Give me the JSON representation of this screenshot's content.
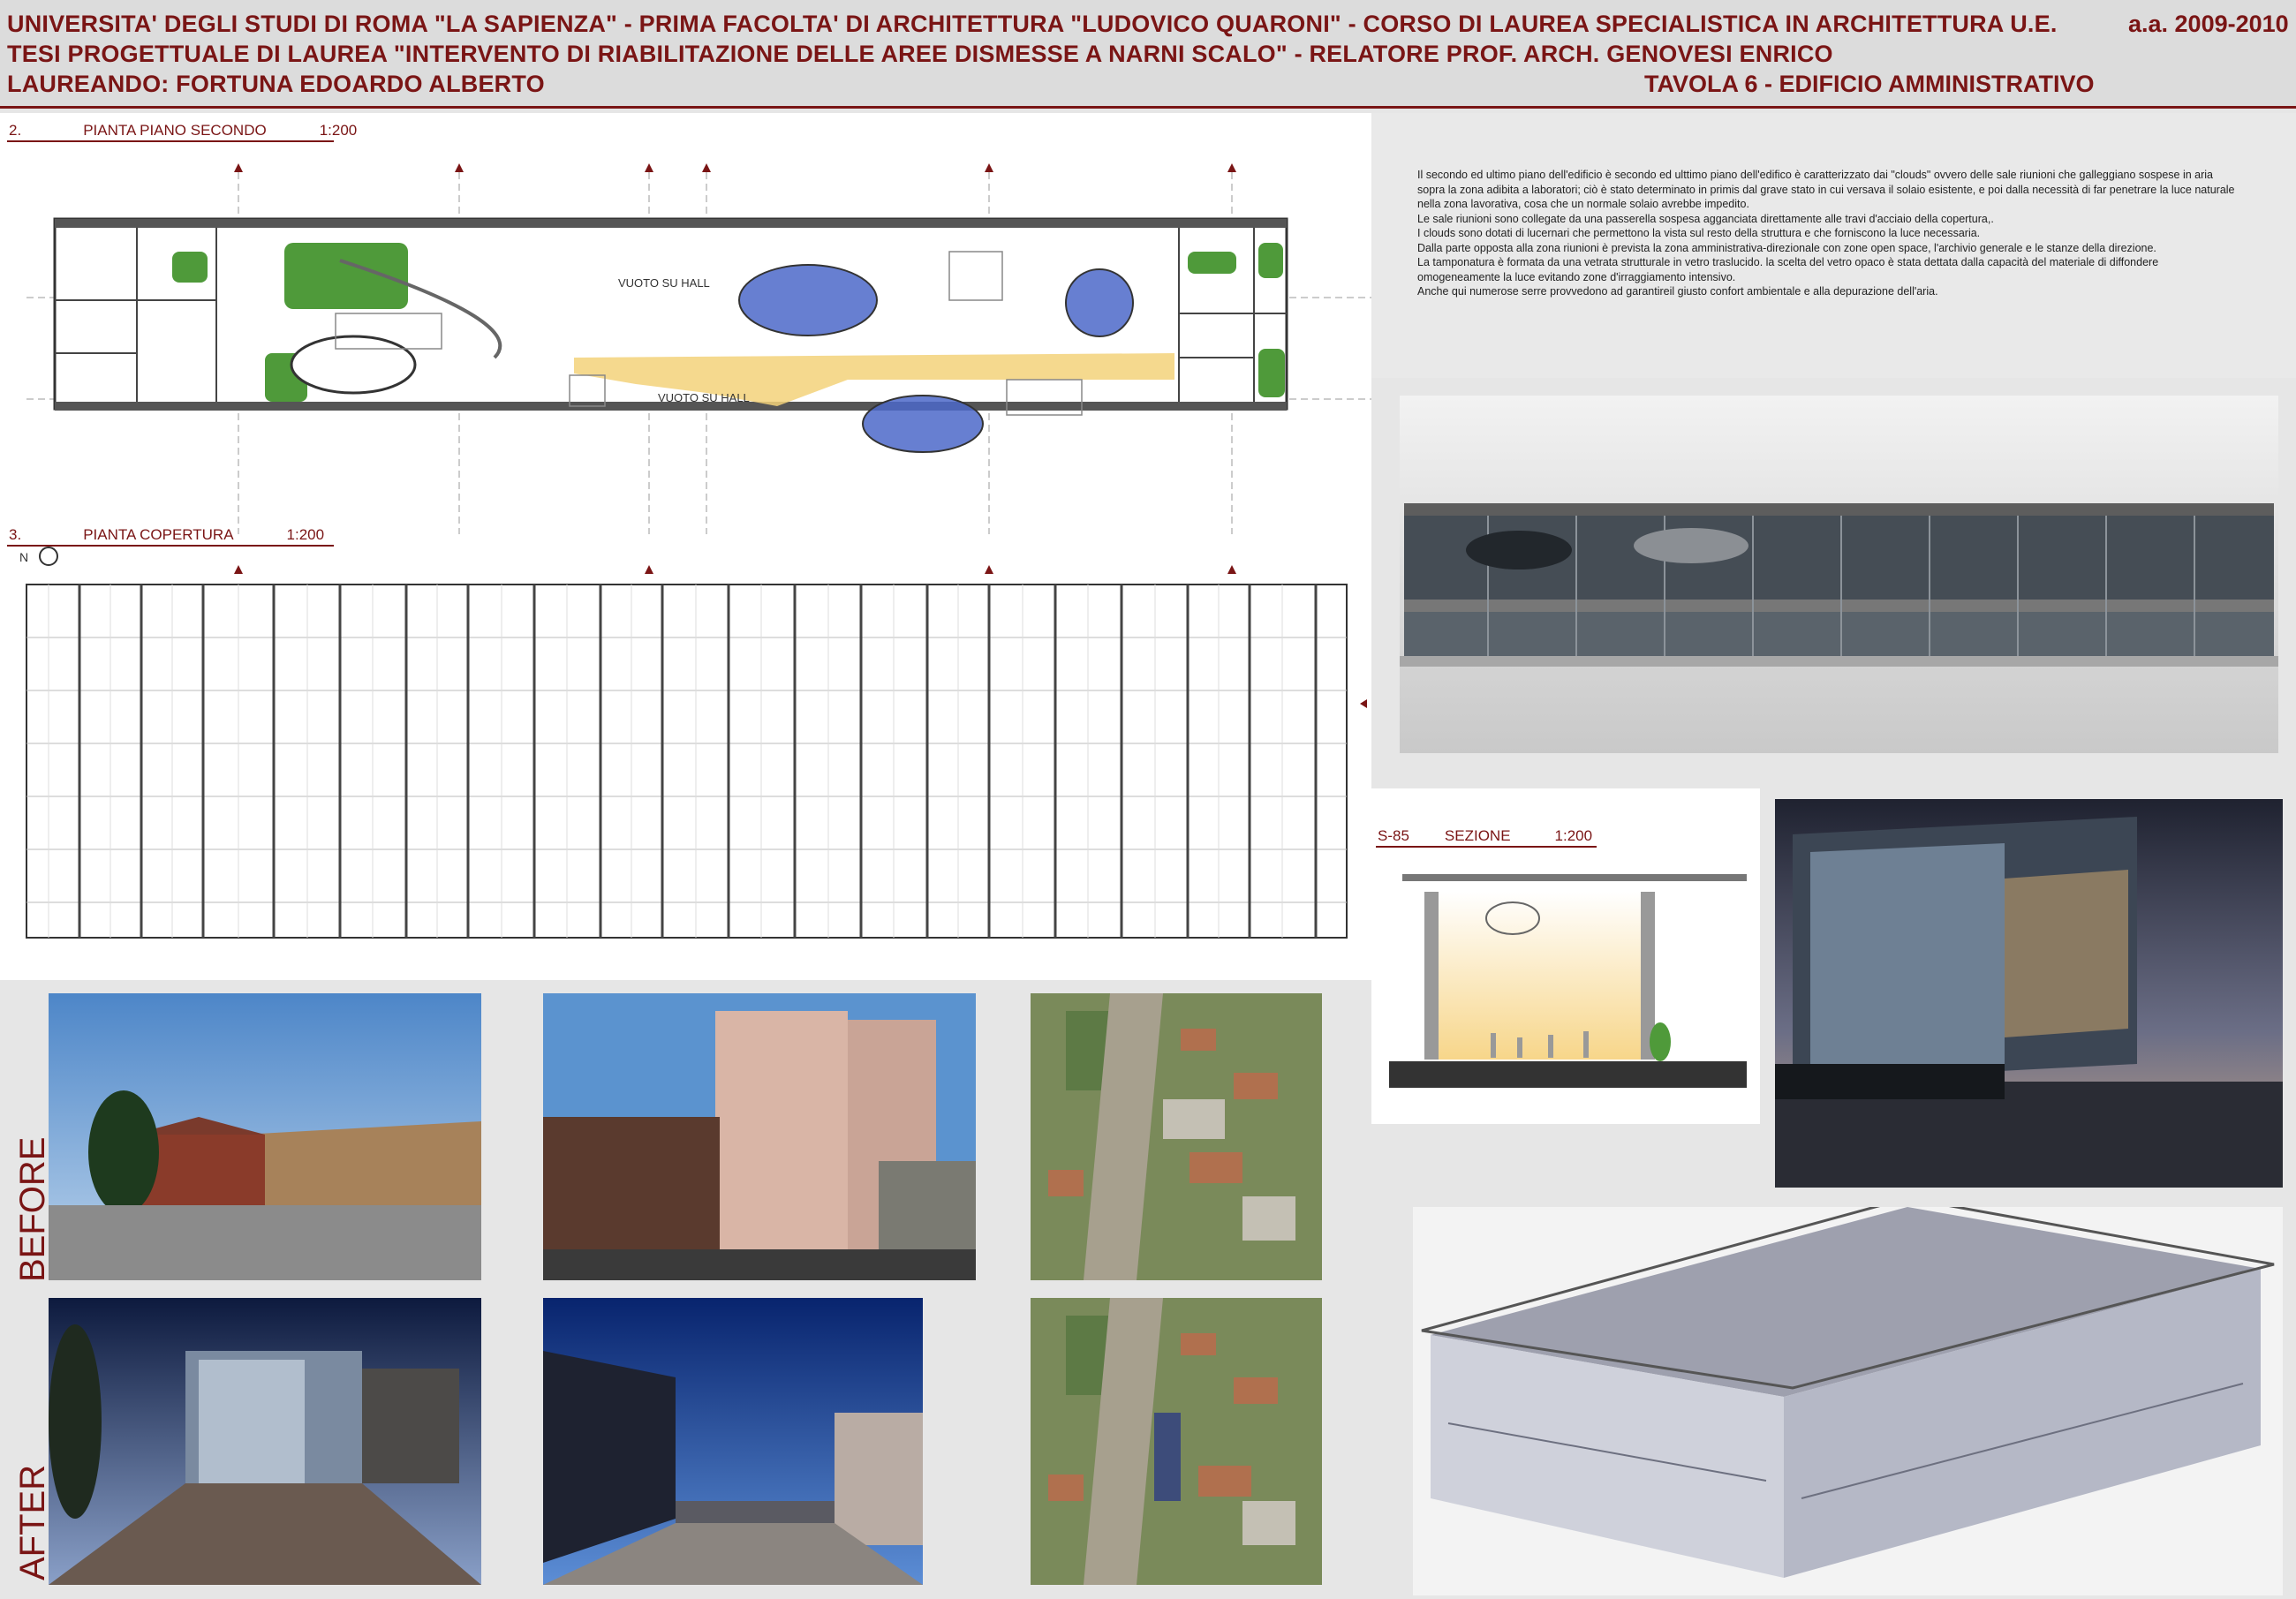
{
  "header": {
    "line1": "UNIVERSITA' DEGLI STUDI DI ROMA \"LA SAPIENZA\" - PRIMA FACOLTA' DI ARCHITETTURA \"LUDOVICO QUARONI\" - CORSO DI LAUREA SPECIALISTICA IN ARCHITETTURA U.E.",
    "academic_year": "a.a. 2009-2010",
    "line2": "TESI PROGETTUALE DI LAUREA   \"INTERVENTO DI RIABILITAZIONE DELLE AREE DISMESSE A NARNI SCALO\" - RELATORE PROF. ARCH. GENOVESI ENRICO",
    "line3": "LAUREANDO: FORTUNA EDOARDO ALBERTO",
    "tavola": "TAVOLA 6 - EDIFICIO AMMINISTRATIVO"
  },
  "plan2": {
    "num": "2.",
    "title": "PIANTA PIANO SECONDO",
    "scale": "1:200",
    "void1": "VUOTO SU HALL",
    "void2": "VUOTO SU HALL"
  },
  "plan3": {
    "num": "3.",
    "title": "PIANTA COPERTURA",
    "scale": "1:200",
    "north": "N"
  },
  "section": {
    "num": "S-85",
    "title": "SEZIONE",
    "scale": "1:200"
  },
  "description": [
    "Il secondo ed ultimo piano dell'edificio è secondo ed ulttimo piano dell'edifico è caratterizzato dai \"clouds\" ovvero delle sale riunioni che galleggiano sospese in aria sopra la zona adibita a laboratori; ciò è stato determinato in primis dal grave stato in cui versava il solaio esistente, e poi dalla necessità di far penetrare la luce naturale nella zona lavorativa, cosa che un normale solaio avrebbe impedito.",
    "Le sale riunioni sono collegate da una passerella sospesa agganciata direttamente alle travi d'acciaio della copertura,.",
    "I clouds sono dotati di lucernari che permettono la vista sul resto della struttura e che forniscono la luce necessaria.",
    "Dalla parte opposta alla zona riunioni è prevista la zona amministrativa-direzionale con zone open space, l'archivio generale e le stanze della direzione.",
    "La tamponatura è formata da una vetrata strutturale in vetro traslucido. la scelta del vetro opaco è stata dettata dalla capacità del materiale di diffondere omogeneamente la luce evitando zone d'irraggiamento intensivo.",
    "Anche qui numerose serre provvedono ad garantireil giusto confort ambientale e alla depurazione dell'aria."
  ],
  "before_label": "BEFORE",
  "after_label": "AFTER",
  "colors": {
    "accent": "#7a1515",
    "cloud": "#4c68c9",
    "walkway": "#f3d27a"
  }
}
